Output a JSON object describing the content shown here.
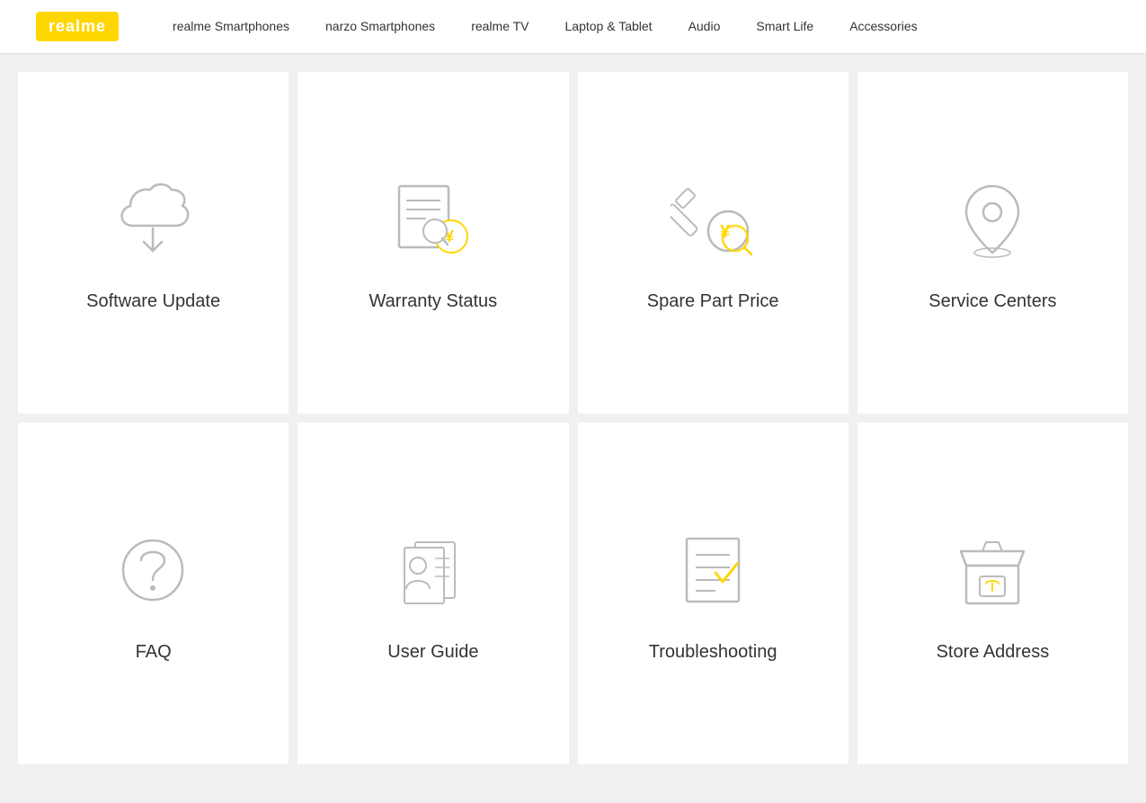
{
  "header": {
    "logo": "realme",
    "nav": [
      {
        "label": "realme Smartphones",
        "id": "nav-realme-smartphones"
      },
      {
        "label": "narzo Smartphones",
        "id": "nav-narzo-smartphones"
      },
      {
        "label": "realme TV",
        "id": "nav-realme-tv"
      },
      {
        "label": "Laptop & Tablet",
        "id": "nav-laptop-tablet"
      },
      {
        "label": "Audio",
        "id": "nav-audio"
      },
      {
        "label": "Smart Life",
        "id": "nav-smart-life"
      },
      {
        "label": "Accessories",
        "id": "nav-accessories"
      }
    ]
  },
  "cards": [
    {
      "id": "software-update",
      "label": "Software Update",
      "icon": "cloud-download"
    },
    {
      "id": "warranty-status",
      "label": "Warranty Status",
      "icon": "warranty"
    },
    {
      "id": "spare-part-price",
      "label": "Spare Part Price",
      "icon": "spare-part"
    },
    {
      "id": "service-centers",
      "label": "Service Centers",
      "icon": "location"
    },
    {
      "id": "faq",
      "label": "FAQ",
      "icon": "question"
    },
    {
      "id": "user-guide",
      "label": "User Guide",
      "icon": "user-guide"
    },
    {
      "id": "troubleshooting",
      "label": "Troubleshooting",
      "icon": "troubleshooting"
    },
    {
      "id": "store-address",
      "label": "Store Address",
      "icon": "store"
    }
  ]
}
